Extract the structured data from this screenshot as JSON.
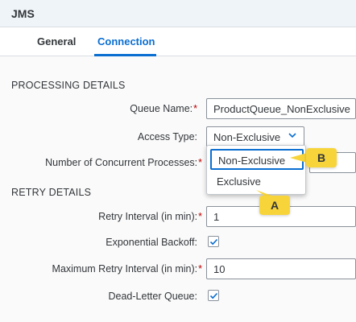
{
  "window": {
    "title": "JMS"
  },
  "tabs": [
    {
      "label": "General"
    },
    {
      "label": "Connection"
    }
  ],
  "processing": {
    "heading": "PROCESSING DETAILS",
    "queue_name": {
      "label": "Queue Name:",
      "value": "ProductQueue_NonExclusive"
    },
    "access_type": {
      "label": "Access Type:",
      "value": "Non-Exclusive"
    },
    "concurrent": {
      "label": "Number of Concurrent Processes:"
    }
  },
  "access_type_options": [
    "Non-Exclusive",
    "Exclusive"
  ],
  "retry": {
    "heading": "RETRY DETAILS",
    "interval": {
      "label": "Retry Interval (in min):",
      "value": "1"
    },
    "backoff": {
      "label": "Exponential Backoff:",
      "checked": true
    },
    "max_interval": {
      "label": "Maximum Retry Interval (in min):",
      "value": "10"
    },
    "dead_letter": {
      "label": "Dead-Letter Queue:",
      "checked": true
    }
  },
  "callouts": {
    "a": "A",
    "b": "B"
  },
  "required_marker": "*",
  "colors": {
    "accent": "#0a6ed1",
    "required": "#bb0000",
    "callout": "#f7d43a"
  }
}
